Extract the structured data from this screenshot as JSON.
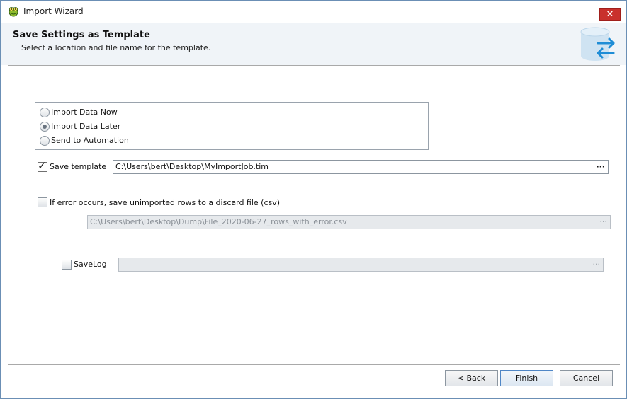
{
  "window": {
    "title": "Import Wizard",
    "close_glyph": "✕"
  },
  "header": {
    "title": "Save Settings as Template",
    "subtitle": "Select a location and file name for the template.",
    "icon": "database-transfer-icon"
  },
  "import_mode": {
    "options": [
      {
        "label": "Import Data Now",
        "selected": false
      },
      {
        "label": "Import Data Later",
        "selected": true
      },
      {
        "label": "Send to Automation",
        "selected": false
      }
    ]
  },
  "save_template": {
    "label": "Save template",
    "checked": true,
    "path": "C:\\Users\\bert\\Desktop\\MyImportJob.tim",
    "browse": "···"
  },
  "discard_file": {
    "label": "If error occurs, save unimported rows to a discard file (csv)",
    "checked": false,
    "path": "C:\\Users\\bert\\Desktop\\Dump\\File_2020-06-27_rows_with_error.csv",
    "browse": "···"
  },
  "save_log": {
    "label": "SaveLog",
    "checked": false,
    "path": "",
    "browse": "···"
  },
  "buttons": {
    "back": "< Back",
    "finish": "Finish",
    "cancel": "Cancel"
  },
  "colors": {
    "close": "#c9302c",
    "accent": "#1f8dd6",
    "header_bg": "#f0f4f8"
  }
}
